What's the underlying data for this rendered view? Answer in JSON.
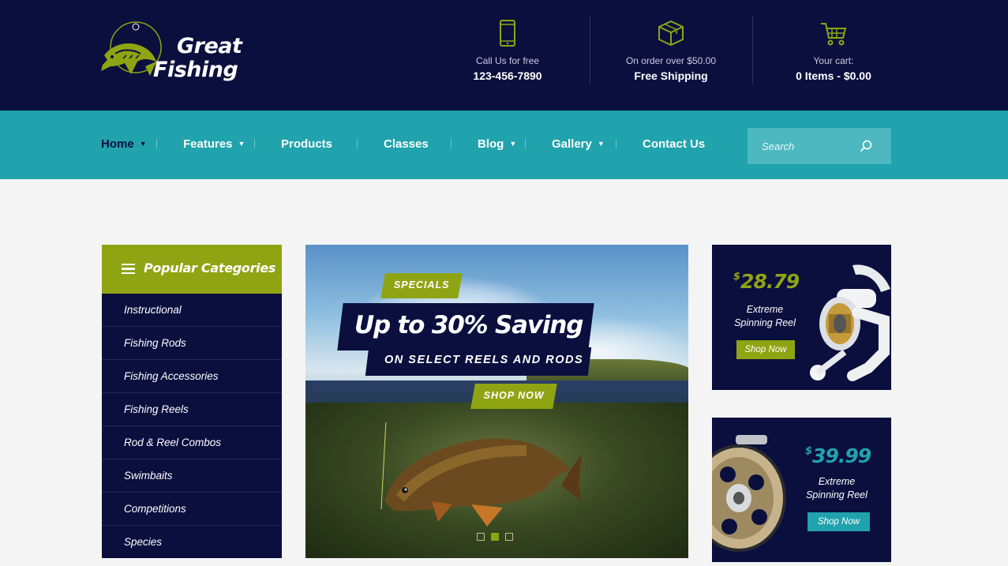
{
  "brand": {
    "line1": "Great",
    "line2": "Fishing"
  },
  "header_info": [
    {
      "icon": "phone-icon",
      "label": "Call Us for free",
      "value": "123-456-7890"
    },
    {
      "icon": "box-icon",
      "label": "On order over $50.00",
      "value": "Free Shipping"
    },
    {
      "icon": "cart-icon",
      "label": "Your cart:",
      "value": "0 Items - $0.00"
    }
  ],
  "nav": {
    "items": [
      {
        "label": "Home",
        "dropdown": true,
        "active": true
      },
      {
        "label": "Features",
        "dropdown": true
      },
      {
        "label": "Products",
        "dropdown": false
      },
      {
        "label": "Classes",
        "dropdown": false
      },
      {
        "label": "Blog",
        "dropdown": true
      },
      {
        "label": "Gallery",
        "dropdown": true
      },
      {
        "label": "Contact Us",
        "dropdown": false
      }
    ],
    "search_placeholder": "Search"
  },
  "categories": {
    "title": "Popular Categories",
    "items": [
      "Instructional",
      "Fishing Rods",
      "Fishing Accessories",
      "Fishing Reels",
      "Rod & Reel Combos",
      "Swimbaits",
      "Competitions",
      "Species"
    ]
  },
  "hero": {
    "badge": "SPECIALS",
    "headline": "Up to 30% Saving",
    "subline": "ON SELECT REELS AND RODS",
    "cta": "SHOP NOW",
    "slides": 3,
    "active_slide": 2
  },
  "promos": [
    {
      "currency": "$",
      "price": "28.79",
      "title_line1": "Extreme",
      "title_line2": "Spinning Reel",
      "button": "Shop Now"
    },
    {
      "currency": "$",
      "price": "39.99",
      "title_line1": "Extreme",
      "title_line2": "Spinning Reel",
      "button": "Shop Now"
    }
  ],
  "colors": {
    "navy": "#0a0f3e",
    "teal": "#20a3ad",
    "olive": "#8fa413"
  }
}
